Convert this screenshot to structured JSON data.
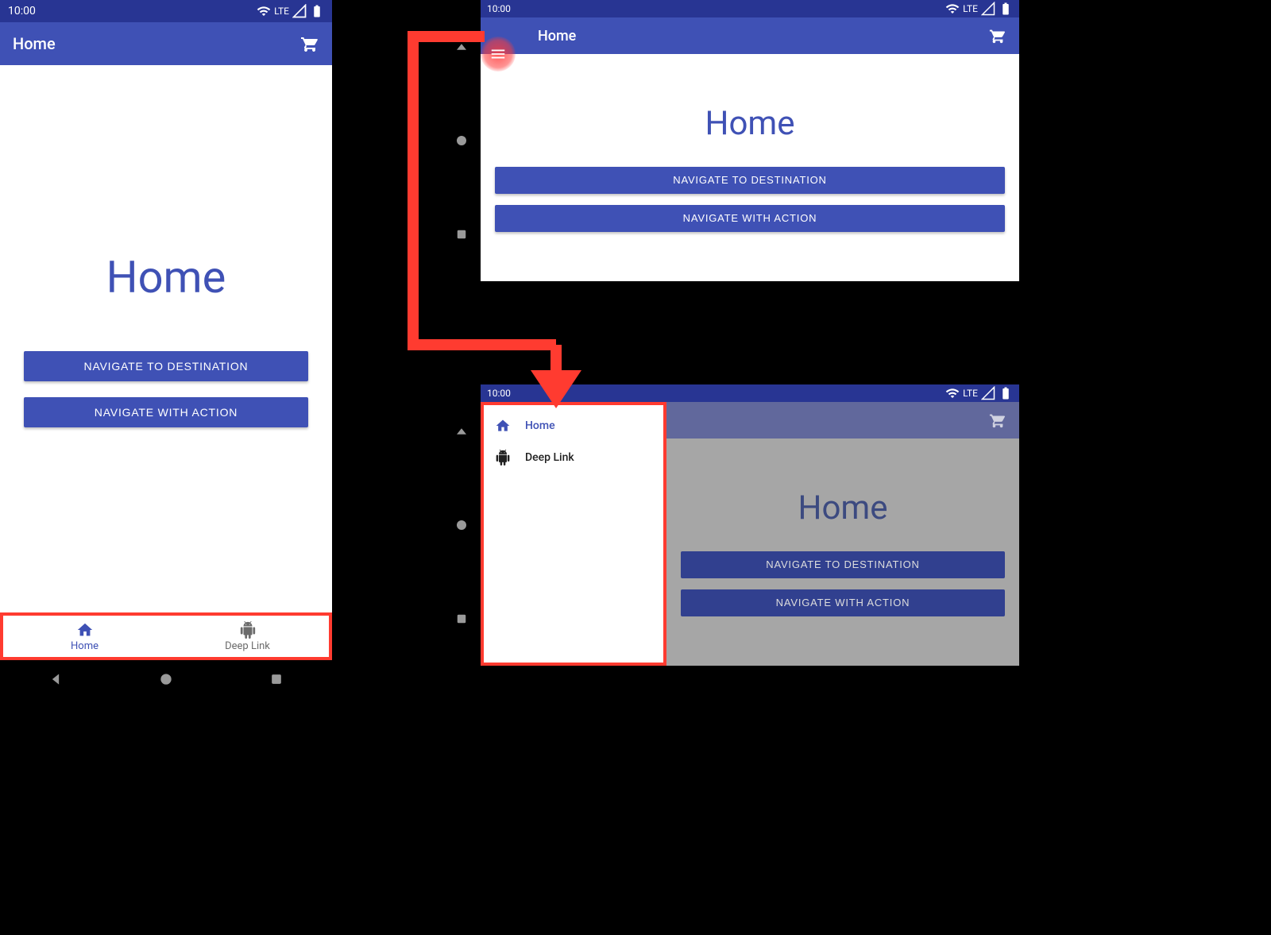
{
  "status": {
    "time": "10:00",
    "network_label": "LTE"
  },
  "actions": {
    "navigate_destination": "NAVIGATE TO DESTINATION",
    "navigate_action": "NAVIGATE WITH ACTION"
  },
  "phone": {
    "appbar_title": "Home",
    "page_heading": "Home",
    "bottom_nav": [
      {
        "label": "Home",
        "active": true
      },
      {
        "label": "Deep Link",
        "active": false
      }
    ]
  },
  "tablet_top": {
    "appbar_title": "Home",
    "page_heading": "Home"
  },
  "tablet_bottom": {
    "page_heading": "Home",
    "drawer": [
      {
        "label": "Home",
        "active": true
      },
      {
        "label": "Deep Link",
        "active": false
      }
    ]
  }
}
